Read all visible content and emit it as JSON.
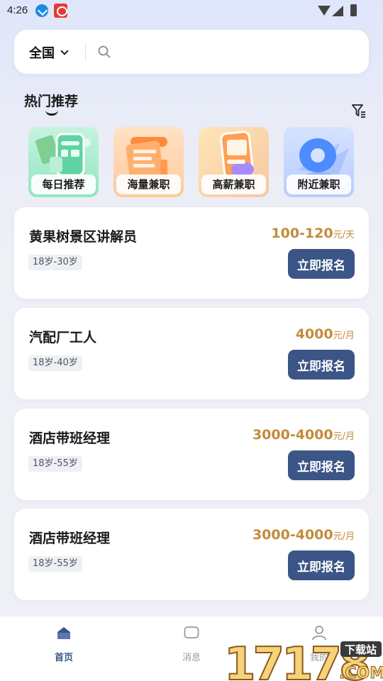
{
  "status_bar": {
    "time": "4:26"
  },
  "search": {
    "region": "全国",
    "placeholder": ""
  },
  "hot_section": {
    "title": "热门推荐",
    "categories": [
      {
        "label": "每日推荐",
        "icon": "daily-recommend-icon"
      },
      {
        "label": "海量兼职",
        "icon": "massive-parttime-icon"
      },
      {
        "label": "高薪兼职",
        "icon": "high-salary-icon"
      },
      {
        "label": "附近兼职",
        "icon": "nearby-location-icon"
      }
    ]
  },
  "jobs": [
    {
      "title": "黄果树景区讲解员",
      "salary": "100-120",
      "unit": "元/天",
      "age": "18岁-30岁",
      "button": "立即报名"
    },
    {
      "title": "汽配厂工人",
      "salary": "4000",
      "unit": "元/月",
      "age": "18岁-40岁",
      "button": "立即报名"
    },
    {
      "title": "酒店带班经理",
      "salary": "3000-4000",
      "unit": "元/月",
      "age": "18岁-55岁",
      "button": "立即报名"
    },
    {
      "title": "酒店带班经理",
      "salary": "3000-4000",
      "unit": "元/月",
      "age": "18岁-55岁",
      "button": "立即报名"
    }
  ],
  "bottom_nav": [
    {
      "label": "首页",
      "icon": "home-icon",
      "active": true
    },
    {
      "label": "消息",
      "icon": "message-icon",
      "active": false
    },
    {
      "label": "我的",
      "icon": "profile-icon",
      "active": false
    }
  ],
  "watermark": {
    "number": "17178",
    "tag": "下载站",
    "suffix": ".COM"
  },
  "colors": {
    "accent": "#3b5587",
    "salary": "#c48b3b",
    "tag_bg": "#eef0f4"
  }
}
